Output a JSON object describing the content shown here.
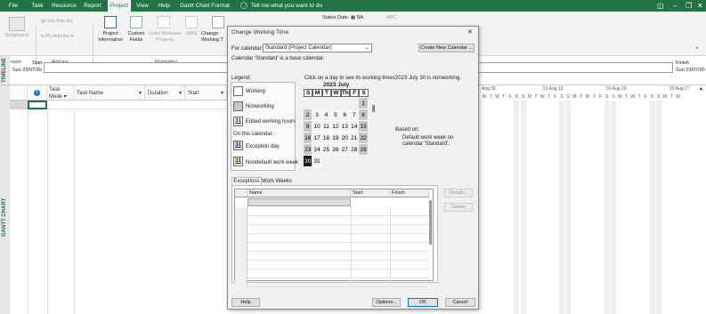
{
  "menubar": {
    "tabs": [
      "File",
      "Task",
      "Resource",
      "Report",
      "Project",
      "View",
      "Help",
      "Gantt Chart Format"
    ],
    "active": "Project",
    "tellme": "Tell me what you want to do"
  },
  "ribbon": {
    "subproject": "Subproject",
    "insert_group": "Insert",
    "get_addins": "Get Add-ins",
    "my_addins": "My Add-ins",
    "addins_group": "Add-ins",
    "project_information": "Project Information",
    "custom_fields": "Custom Fields",
    "links_between_projects": "Links Between Projects",
    "wbs": "WBS",
    "change_working_time": "Change Working T",
    "properties_group": "Properties",
    "status_date_label": "Status Date:",
    "status_date_value": "NA"
  },
  "timeline": {
    "label": "TIMELINE",
    "start_label": "Start",
    "start_date": "Sun 23/07/30",
    "finish_label": "Finish",
    "finish_date": "Sun 23/07/30"
  },
  "gantt": {
    "side_label": "GANTT CHART",
    "columns": [
      "Task Mode",
      "Task Name",
      "Duration",
      "Start"
    ],
    "weeks": [
      "Aug 06",
      "'23 Aug 13",
      "'23 Aug 20",
      "'23 Aug 27"
    ],
    "days": [
      "M",
      "T",
      "W",
      "T",
      "F",
      "S",
      "S",
      "M",
      "T",
      "W",
      "T",
      "F",
      "S",
      "S",
      "M",
      "T",
      "W",
      "T",
      "F",
      "S",
      "S",
      "M",
      "T",
      "W",
      "T",
      "F",
      "S",
      "S",
      "M",
      "T",
      "W"
    ]
  },
  "dialog": {
    "title": "Change Working Time",
    "for_calendar_label": "For calendar:",
    "calendar_value": "Standard (Project Calendar)",
    "create_new": "Create New Calendar ...",
    "base_note": "Calendar 'Standard' is a base calendar.",
    "legend_label": "Legend:",
    "legend_working": "Working",
    "legend_nonworking": "Nonworking",
    "legend_edited": "Edited working hours",
    "on_this_calendar": "On this calendar:",
    "legend_exception": "Exception day",
    "legend_nondefault": "Nondefault work week",
    "legend_num": "31",
    "click_hint": "Click on a day to see its working times:",
    "day_status": "2023 July 30 is nonworking.",
    "month_title": "2023 July",
    "weekday_headers": [
      "S",
      "M",
      "T",
      "W",
      "Th",
      "F",
      "S"
    ],
    "weeks": [
      [
        "",
        "",
        "",
        "",
        "",
        "",
        "1"
      ],
      [
        "2",
        "3",
        "4",
        "5",
        "6",
        "7",
        "8"
      ],
      [
        "9",
        "10",
        "11",
        "12",
        "13",
        "14",
        "15"
      ],
      [
        "16",
        "17",
        "18",
        "19",
        "20",
        "21",
        "22"
      ],
      [
        "23",
        "24",
        "25",
        "26",
        "27",
        "28",
        "29"
      ],
      [
        "30",
        "31",
        "",
        "",
        "",
        "",
        ""
      ]
    ],
    "selected_day": "30",
    "based_on_label": "Based on:",
    "based_on_text": "Default work week on calendar 'Standard'.",
    "tabs": [
      "Exceptions",
      "Work Weeks"
    ],
    "ex_columns": [
      "Name",
      "Start",
      "Finish"
    ],
    "details": "Details...",
    "delete": "Delete",
    "help": "Help",
    "options": "Options...",
    "ok": "OK",
    "cancel": "Cancel"
  }
}
